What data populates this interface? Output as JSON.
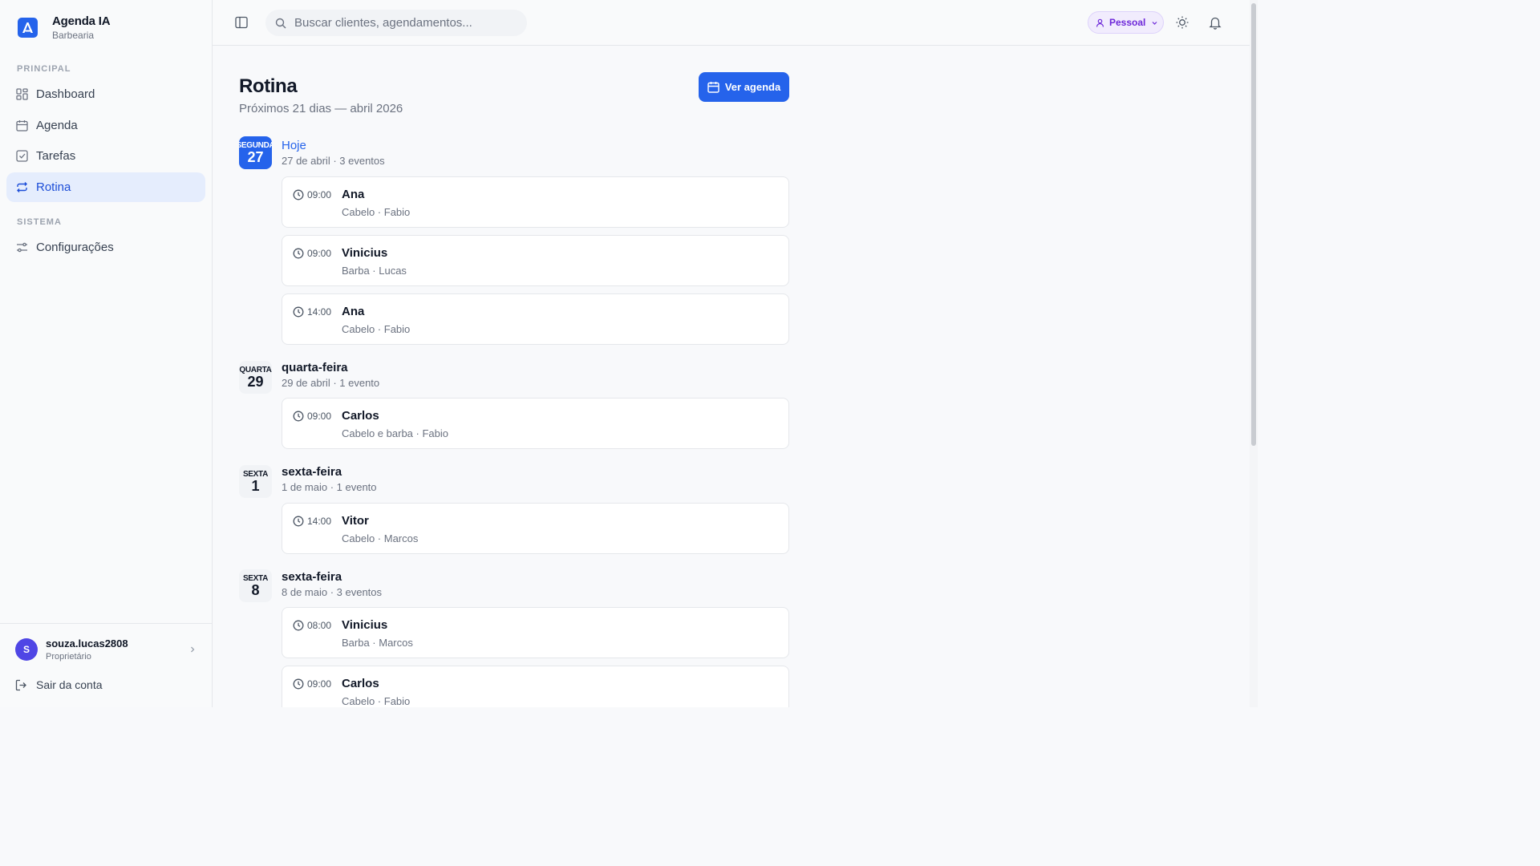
{
  "brand": {
    "name": "Agenda IA",
    "subtitle": "Barbearia"
  },
  "sidebar": {
    "sections": [
      {
        "label": "PRINCIPAL",
        "items": [
          {
            "label": "Dashboard",
            "icon": "grid-icon",
            "active": false
          },
          {
            "label": "Agenda",
            "icon": "calendar-icon",
            "active": false
          },
          {
            "label": "Tarefas",
            "icon": "checkbox-icon",
            "active": false
          },
          {
            "label": "Rotina",
            "icon": "repeat-icon",
            "active": true
          }
        ]
      },
      {
        "label": "SISTEMA",
        "items": [
          {
            "label": "Configurações",
            "icon": "sliders-icon",
            "active": false
          }
        ]
      }
    ],
    "user": {
      "initial": "S",
      "name": "souza.lucas2808",
      "role": "Proprietário"
    },
    "logout_label": "Sair da conta"
  },
  "topbar": {
    "search_placeholder": "Buscar clientes, agendamentos...",
    "profile_pill": "Pessoal"
  },
  "main": {
    "title": "Rotina",
    "subtitle": "Próximos 21 dias — abril 2026",
    "primary_button": "Ver agenda"
  },
  "days": [
    {
      "weekday_short": "SEGUNDA",
      "day": "27",
      "title": "Hoje",
      "meta": "27 de abril · 3 eventos",
      "today": true,
      "events": [
        {
          "time": "09:00",
          "name": "Ana",
          "detail": "Cabelo · Fabio"
        },
        {
          "time": "09:00",
          "name": "Vinicius",
          "detail": "Barba · Lucas"
        },
        {
          "time": "14:00",
          "name": "Ana",
          "detail": "Cabelo · Fabio"
        }
      ]
    },
    {
      "weekday_short": "QUARTA",
      "day": "29",
      "title": "quarta-feira",
      "meta": "29 de abril · 1 evento",
      "today": false,
      "events": [
        {
          "time": "09:00",
          "name": "Carlos",
          "detail": "Cabelo e barba · Fabio"
        }
      ]
    },
    {
      "weekday_short": "SEXTA",
      "day": "1",
      "title": "sexta-feira",
      "meta": "1 de maio · 1 evento",
      "today": false,
      "events": [
        {
          "time": "14:00",
          "name": "Vitor",
          "detail": "Cabelo · Marcos"
        }
      ]
    },
    {
      "weekday_short": "SEXTA",
      "day": "8",
      "title": "sexta-feira",
      "meta": "8 de maio · 3 eventos",
      "today": false,
      "events": [
        {
          "time": "08:00",
          "name": "Vinicius",
          "detail": "Barba · Marcos"
        },
        {
          "time": "09:00",
          "name": "Carlos",
          "detail": "Cabelo · Fabio"
        }
      ]
    }
  ],
  "colors": {
    "accent": "#2563eb",
    "active_bg": "#e5edfd",
    "pill_text": "#6d28d9"
  }
}
